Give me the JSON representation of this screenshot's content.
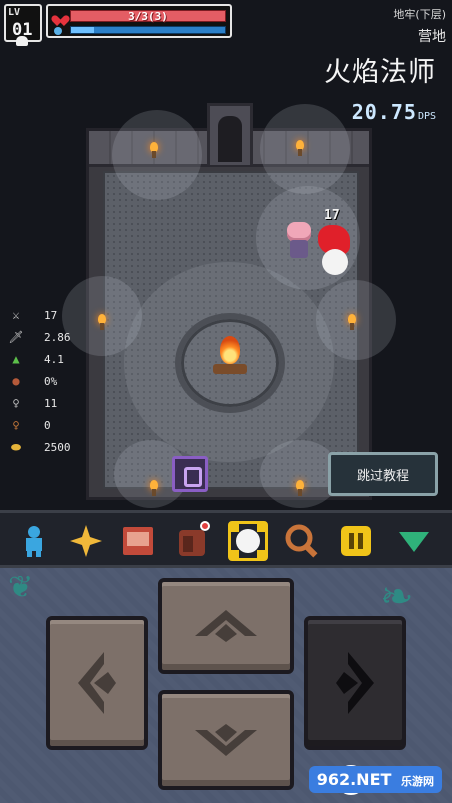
{
  "hud": {
    "level_tag": "LV",
    "level": "01",
    "hp_text": "3/3(3)",
    "mp_fraction": 0.15,
    "location_top": "地牢(下层)",
    "location_sub": "营地",
    "class_name": "火焰法师",
    "dps_value": "20.75",
    "dps_unit": "DPS"
  },
  "combat": {
    "damage_number": "17"
  },
  "stats": [
    {
      "icon": "crossed-swords-icon",
      "glyph": "⚔",
      "value": "17",
      "color": "#c8c8c8"
    },
    {
      "icon": "sword-speed-icon",
      "glyph": "🗡",
      "value": "2.86",
      "color": "#c8c8c8"
    },
    {
      "icon": "boot-icon",
      "glyph": "▲",
      "value": "4.1",
      "color": "#5cbf4a"
    },
    {
      "icon": "pot-icon",
      "glyph": "●",
      "value": "0%",
      "color": "#b55a3a"
    },
    {
      "icon": "silver-key-icon",
      "glyph": "♀",
      "value": "11",
      "color": "#c0c0c0"
    },
    {
      "icon": "bronze-key-icon",
      "glyph": "♀",
      "value": "0",
      "color": "#c97a3a"
    },
    {
      "icon": "gold-coin-icon",
      "glyph": "⬬",
      "value": "2500",
      "color": "#e6b43a"
    }
  ],
  "skip_button_label": "跳过教程",
  "skills": [
    {
      "name": "character-icon",
      "color": "#3aa6e0",
      "active": false
    },
    {
      "name": "sparkle-icon",
      "color": "#f0b83a",
      "active": false
    },
    {
      "name": "spellbook-icon",
      "color": "#c24a3a",
      "active": false
    },
    {
      "name": "backpack-icon",
      "color": "#8a3a2a",
      "active": false,
      "badge": true
    },
    {
      "name": "target-icon",
      "color": "#f4f4f4",
      "active": true
    },
    {
      "name": "magnifier-icon",
      "color": "#c9743a",
      "active": false
    },
    {
      "name": "pause-icon",
      "color": "#f0c419",
      "active": false
    },
    {
      "name": "dropdown-icon",
      "color": "#2fb27a",
      "active": false
    }
  ],
  "watermark": "962.NET",
  "watermark_sub": "乐游网"
}
